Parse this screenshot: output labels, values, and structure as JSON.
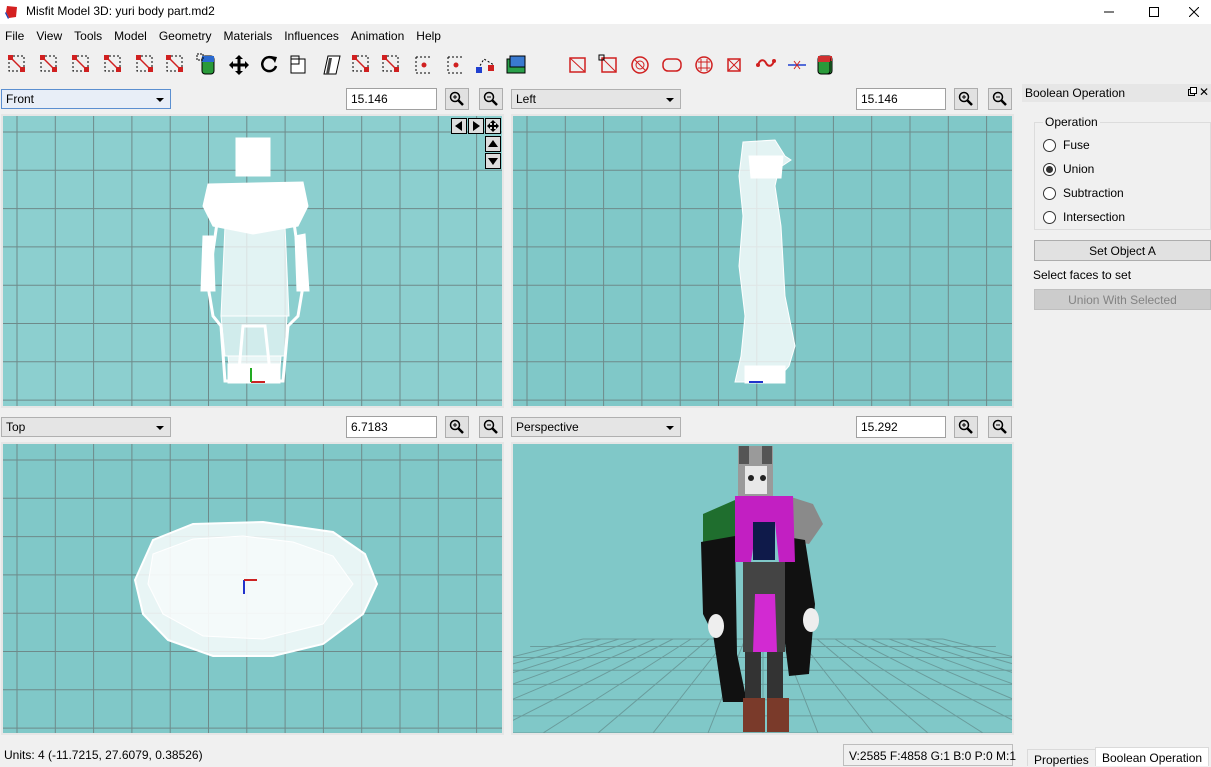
{
  "window": {
    "title": "Misfit Model 3D: yuri body part.md2",
    "controls": [
      "minimize",
      "maximize",
      "close"
    ]
  },
  "menu": [
    "File",
    "View",
    "Tools",
    "Model",
    "Geometry",
    "Materials",
    "Influences",
    "Animation",
    "Help"
  ],
  "toolbar": [
    "select-vertices-icon",
    "select-faces-icon",
    "select-connected-icon",
    "select-groups-icon",
    "select-bone-joints-icon",
    "select-points-icon",
    "select-projections-icon",
    "move-icon",
    "rotate-icon",
    "scale-icon",
    "shear-icon",
    "create-vertex-icon",
    "create-face-icon",
    "create-bone-joint-icon",
    "create-point-icon",
    "attach-icon",
    "background-image-icon",
    "create-rectangle-icon",
    "create-cube-icon",
    "create-ellipsoid-icon",
    "create-cylinder-icon",
    "create-torus-icon",
    "create-polygon-icon",
    "drag-vertex-icon",
    "bone-joint-link-icon",
    "create-projection-icon",
    "paint-texture-icon"
  ],
  "viewports": {
    "front": {
      "label": "Front",
      "zoom": "15.146"
    },
    "left": {
      "label": "Left",
      "zoom": "15.146"
    },
    "top": {
      "label": "Top",
      "zoom": "6.7183"
    },
    "perspective": {
      "label": "Perspective",
      "zoom": "15.292"
    }
  },
  "colors": {
    "viewport_bg": "#7fc4c4",
    "grid": "#6e8a8a",
    "wire": "#ffffff"
  },
  "panel": {
    "title": "Boolean Operation",
    "group_title": "Operation",
    "options": [
      "Fuse",
      "Union",
      "Subtraction",
      "Intersection"
    ],
    "selected": "Union",
    "set_object_button": "Set Object A",
    "hint": "Select faces to set",
    "apply_button": "Union With Selected"
  },
  "status": {
    "units": "Units: 4  (-11.7215, 27.6079, 0.38526)",
    "counts": "V:2585 F:4858 G:1 B:0 P:0 M:1"
  },
  "tabs": [
    "Properties",
    "Boolean Operation"
  ]
}
